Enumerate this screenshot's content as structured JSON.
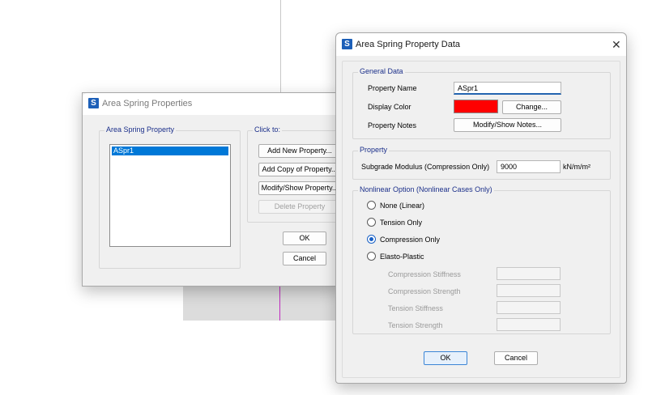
{
  "background": {
    "line_color": "#c8c8c8",
    "magenta": "#c02cc0"
  },
  "back_dialog": {
    "title": "Area Spring Properties",
    "app_icon": "S",
    "list_group_label": "Area Spring Property",
    "list_items": [
      "ASpr1"
    ],
    "click_group_label": "Click to:",
    "buttons": {
      "add_new": "Add New Property...",
      "add_copy": "Add Copy of Property...",
      "modify_show": "Modify/Show Property...",
      "delete": "Delete Property",
      "ok": "OK",
      "cancel": "Cancel"
    }
  },
  "front_dialog": {
    "title": "Area Spring Property Data",
    "app_icon": "S",
    "close_glyph": "✕",
    "general": {
      "label": "General Data",
      "property_name_label": "Property Name",
      "property_name_value": "ASpr1",
      "display_color_label": "Display Color",
      "display_color": "#ff0000",
      "change_button": "Change...",
      "property_notes_label": "Property Notes",
      "notes_button": "Modify/Show Notes..."
    },
    "property": {
      "label": "Property",
      "subgrade_label": "Subgrade Modulus  (Compression Only)",
      "subgrade_value": "9000",
      "subgrade_unit": "kN/m/m²"
    },
    "nonlinear": {
      "label": "Nonlinear Option  (Nonlinear Cases Only)",
      "options": [
        "None (Linear)",
        "Tension Only",
        "Compression Only",
        "Elasto-Plastic"
      ],
      "selected": "Compression Only",
      "compression_stiffness_label": "Compression Stiffness",
      "compression_strength_label": "Compression Strength",
      "tension_stiffness_label": "Tension Stiffness",
      "tension_strength_label": "Tension Strength"
    },
    "ok": "OK",
    "cancel": "Cancel"
  }
}
